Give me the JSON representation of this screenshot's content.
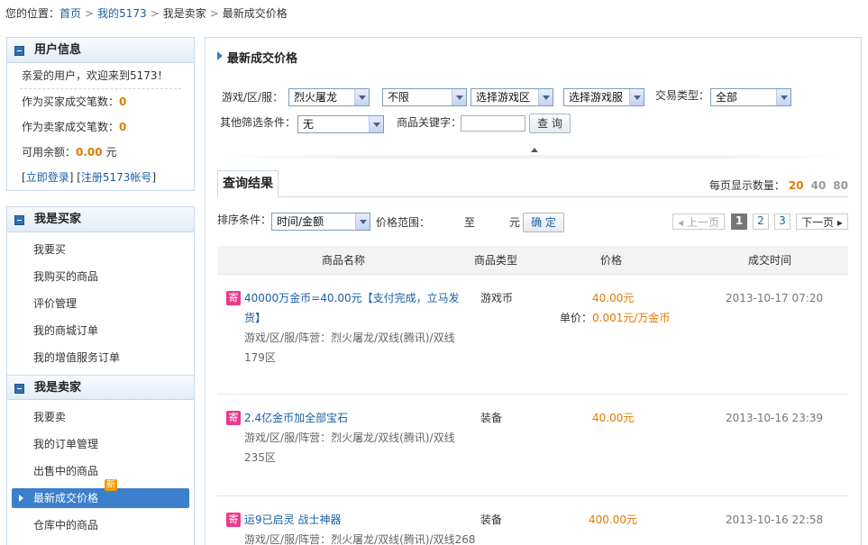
{
  "breadcrumb": {
    "prefix": "您的位置：",
    "items": [
      "首页",
      "我的5173",
      "我是卖家",
      "最新成交价格"
    ]
  },
  "user_info": {
    "title": "用户信息",
    "welcome": "亲爱的用户，欢迎来到5173！",
    "buyer_label": "作为买家成交笔数：",
    "buyer_count": "0",
    "seller_label": "作为卖家成交笔数：",
    "seller_count": "0",
    "balance_label": "可用余额：",
    "balance_value": "0.00",
    "balance_unit": "元",
    "login_link": "立即登录",
    "register_link": "注册5173帐号"
  },
  "buyer_menu": {
    "title": "我是买家",
    "items": [
      "我要买",
      "我购买的商品",
      "评价管理",
      "我的商城订单",
      "我的增值服务订单"
    ]
  },
  "seller_menu": {
    "title": "我是卖家",
    "items": [
      "我要卖",
      "我的订单管理",
      "出售中的商品",
      "最新成交价格",
      "仓库中的商品"
    ],
    "active_index": 3,
    "new_badge": "新"
  },
  "main": {
    "title": "最新成交价格",
    "filters": {
      "game_label": "游戏/区/服：",
      "game_value": "烈火屠龙",
      "filter2_value": "不限",
      "area_value": "选择游戏区",
      "server_value": "选择游戏服",
      "trade_type_label": "交易类型：",
      "trade_type_value": "全部",
      "other_label": "其他筛选条件：",
      "other_value": "无",
      "keyword_label": "商品关键字：",
      "keyword_value": "",
      "search_button": "查 询"
    },
    "results_tab": "查询结果",
    "per_page_label": "每页显示数量：",
    "per_page_options": [
      "20",
      "40",
      "80"
    ],
    "sort": {
      "label": "排序条件：",
      "value": "时间/金额",
      "price_range_label": "价格范围：",
      "to": "至",
      "unit": "元",
      "confirm_button": "确 定"
    },
    "pager": {
      "prev": "上一页",
      "pages": [
        "1",
        "2",
        "3"
      ],
      "next": "下一页"
    },
    "table": {
      "headers": [
        "商品名称",
        "商品类型",
        "价格",
        "成交时间"
      ],
      "rows": [
        {
          "badge": "寄",
          "name": "40000万金币=40.00元【支付完成，立马发货】",
          "desc": "游戏/区/服/阵营：烈火屠龙/双线(腾讯)/双线179区",
          "type": "游戏币",
          "price": "40.00元",
          "unit_label": "单价：",
          "unit_price": "0.001元/万金币",
          "time": "2013-10-17 07:20"
        },
        {
          "badge": "寄",
          "name": "2.4亿金币加全部宝石",
          "desc": "游戏/区/服/阵营：烈火屠龙/双线(腾讯)/双线235区",
          "type": "装备",
          "price": "40.00元",
          "time": "2013-10-16 23:39"
        },
        {
          "badge": "寄",
          "name": "运9已启灵 战士神器",
          "desc": "游戏/区/服/阵营：烈火屠龙/双线(腾讯)/双线268",
          "type": "装备",
          "price": "400.00元",
          "time": "2013-10-16 22:58"
        }
      ]
    }
  },
  "colors": {
    "link": "#1a5fa5",
    "accent_orange": "#e07a00",
    "active_menu": "#3b7fcd",
    "badge_pink": "#e83a8b",
    "panel_border": "#c9d9ea"
  }
}
